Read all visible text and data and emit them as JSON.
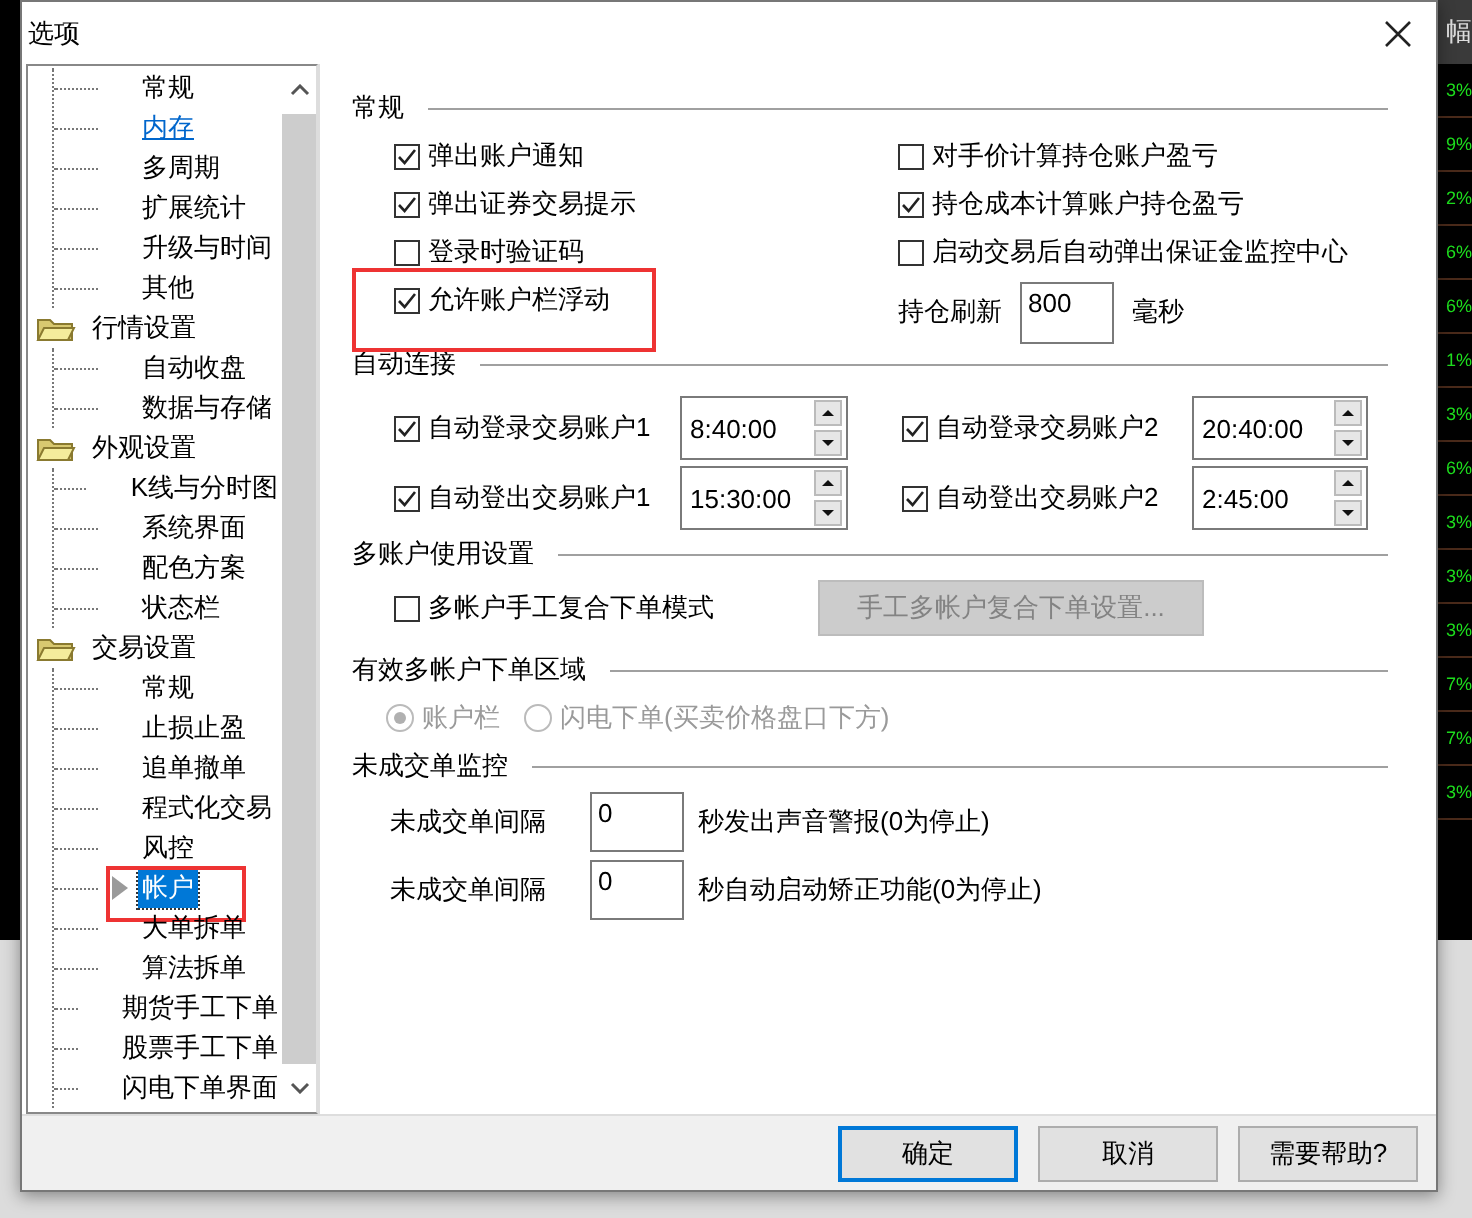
{
  "window": {
    "title": "选项"
  },
  "tree": {
    "items": [
      {
        "label": "常规",
        "selected": false,
        "hot": false,
        "highlighted": false
      },
      {
        "label": "内存",
        "selected": false,
        "hot": true,
        "highlighted": false
      },
      {
        "label": "多周期",
        "selected": false,
        "hot": false,
        "highlighted": false
      },
      {
        "label": "扩展统计",
        "selected": false,
        "hot": false,
        "highlighted": false
      },
      {
        "label": "升级与时间",
        "selected": false,
        "hot": false,
        "highlighted": false
      },
      {
        "label": "其他",
        "selected": false,
        "hot": false,
        "highlighted": false
      }
    ],
    "folders": [
      {
        "label": "行情设置",
        "expanded": true,
        "children": [
          {
            "label": "自动收盘",
            "selected": false,
            "hot": false,
            "highlighted": false
          },
          {
            "label": "数据与存储",
            "selected": false,
            "hot": false,
            "highlighted": false
          }
        ]
      },
      {
        "label": "外观设置",
        "expanded": true,
        "children": [
          {
            "label": "K线与分时图",
            "selected": false,
            "hot": false,
            "highlighted": false
          },
          {
            "label": "系统界面",
            "selected": false,
            "hot": false,
            "highlighted": false
          },
          {
            "label": "配色方案",
            "selected": false,
            "hot": false,
            "highlighted": false
          },
          {
            "label": "状态栏",
            "selected": false,
            "hot": false,
            "highlighted": false
          }
        ]
      },
      {
        "label": "交易设置",
        "expanded": true,
        "children": [
          {
            "label": "常规",
            "selected": false,
            "hot": false,
            "highlighted": false
          },
          {
            "label": "止损止盈",
            "selected": false,
            "hot": false,
            "highlighted": false
          },
          {
            "label": "追单撤单",
            "selected": false,
            "hot": false,
            "highlighted": false
          },
          {
            "label": "程式化交易",
            "selected": false,
            "hot": false,
            "highlighted": false
          },
          {
            "label": "风控",
            "selected": false,
            "hot": false,
            "highlighted": false
          },
          {
            "label": "帐户",
            "selected": true,
            "hot": false,
            "highlighted": true
          },
          {
            "label": "大单拆单",
            "selected": false,
            "hot": false,
            "highlighted": false
          },
          {
            "label": "算法拆单",
            "selected": false,
            "hot": false,
            "highlighted": false
          },
          {
            "label": "期货手工下单",
            "selected": false,
            "hot": false,
            "highlighted": false
          },
          {
            "label": "股票手工下单",
            "selected": false,
            "hot": false,
            "highlighted": false
          },
          {
            "label": "闪电下单界面",
            "selected": false,
            "hot": false,
            "highlighted": false
          }
        ]
      }
    ]
  },
  "general": {
    "title": "常规",
    "left": [
      {
        "label": "弹出账户通知",
        "checked": true,
        "highlighted": false
      },
      {
        "label": "弹出证券交易提示",
        "checked": true,
        "highlighted": false
      },
      {
        "label": "登录时验证码",
        "checked": false,
        "highlighted": false
      },
      {
        "label": "允许账户栏浮动",
        "checked": true,
        "highlighted": true
      }
    ],
    "right": [
      {
        "label": "对手价计算持仓账户盈亏",
        "checked": false,
        "highlighted": false
      },
      {
        "label": "持仓成本计算账户持仓盈亏",
        "checked": true,
        "highlighted": false
      },
      {
        "label": "启动交易后自动弹出保证金监控中心",
        "checked": false,
        "highlighted": false
      }
    ],
    "refresh": {
      "label": "持仓刷新",
      "value": "800",
      "unit": "毫秒"
    }
  },
  "auto_connect": {
    "title": "自动连接",
    "rows": [
      [
        {
          "label": "自动登录交易账户1",
          "checked": true,
          "time": "8:40:00"
        },
        {
          "label": "自动登录交易账户2",
          "checked": true,
          "time": "20:40:00"
        }
      ],
      [
        {
          "label": "自动登出交易账户1",
          "checked": true,
          "time": "15:30:00"
        },
        {
          "label": "自动登出交易账户2",
          "checked": true,
          "time": "2:45:00"
        }
      ]
    ]
  },
  "multi": {
    "title": "多账户使用设置",
    "option": {
      "label": "多帐户手工复合下单模式",
      "checked": false
    },
    "button": {
      "label": "手工多帐户复合下单设置...",
      "disabled": true
    }
  },
  "zone": {
    "title": "有效多帐户下单区域",
    "disabled": true,
    "options": [
      {
        "label": "账户栏",
        "selected": true
      },
      {
        "label": "闪电下单(买卖价格盘口下方)",
        "selected": false
      }
    ]
  },
  "monitor": {
    "title": "未成交单监控",
    "rows": [
      {
        "label": "未成交单间隔",
        "value": "0",
        "suffix": "秒发出声音警报(0为停止)"
      },
      {
        "label": "未成交单间隔",
        "value": "0",
        "suffix": "秒自动启动矫正功能(0为停止)"
      }
    ]
  },
  "buttons": [
    {
      "label": "确定",
      "default": true
    },
    {
      "label": "取消",
      "default": false
    },
    {
      "label": "需要帮助?",
      "default": false
    }
  ],
  "background": {
    "column_header": "幅",
    "values": [
      "3%",
      "9%",
      "2%",
      "6%",
      "6%",
      "1%",
      "3%",
      "6%",
      "3%",
      "3%",
      "3%",
      "7%",
      "7%",
      "3%"
    ]
  }
}
